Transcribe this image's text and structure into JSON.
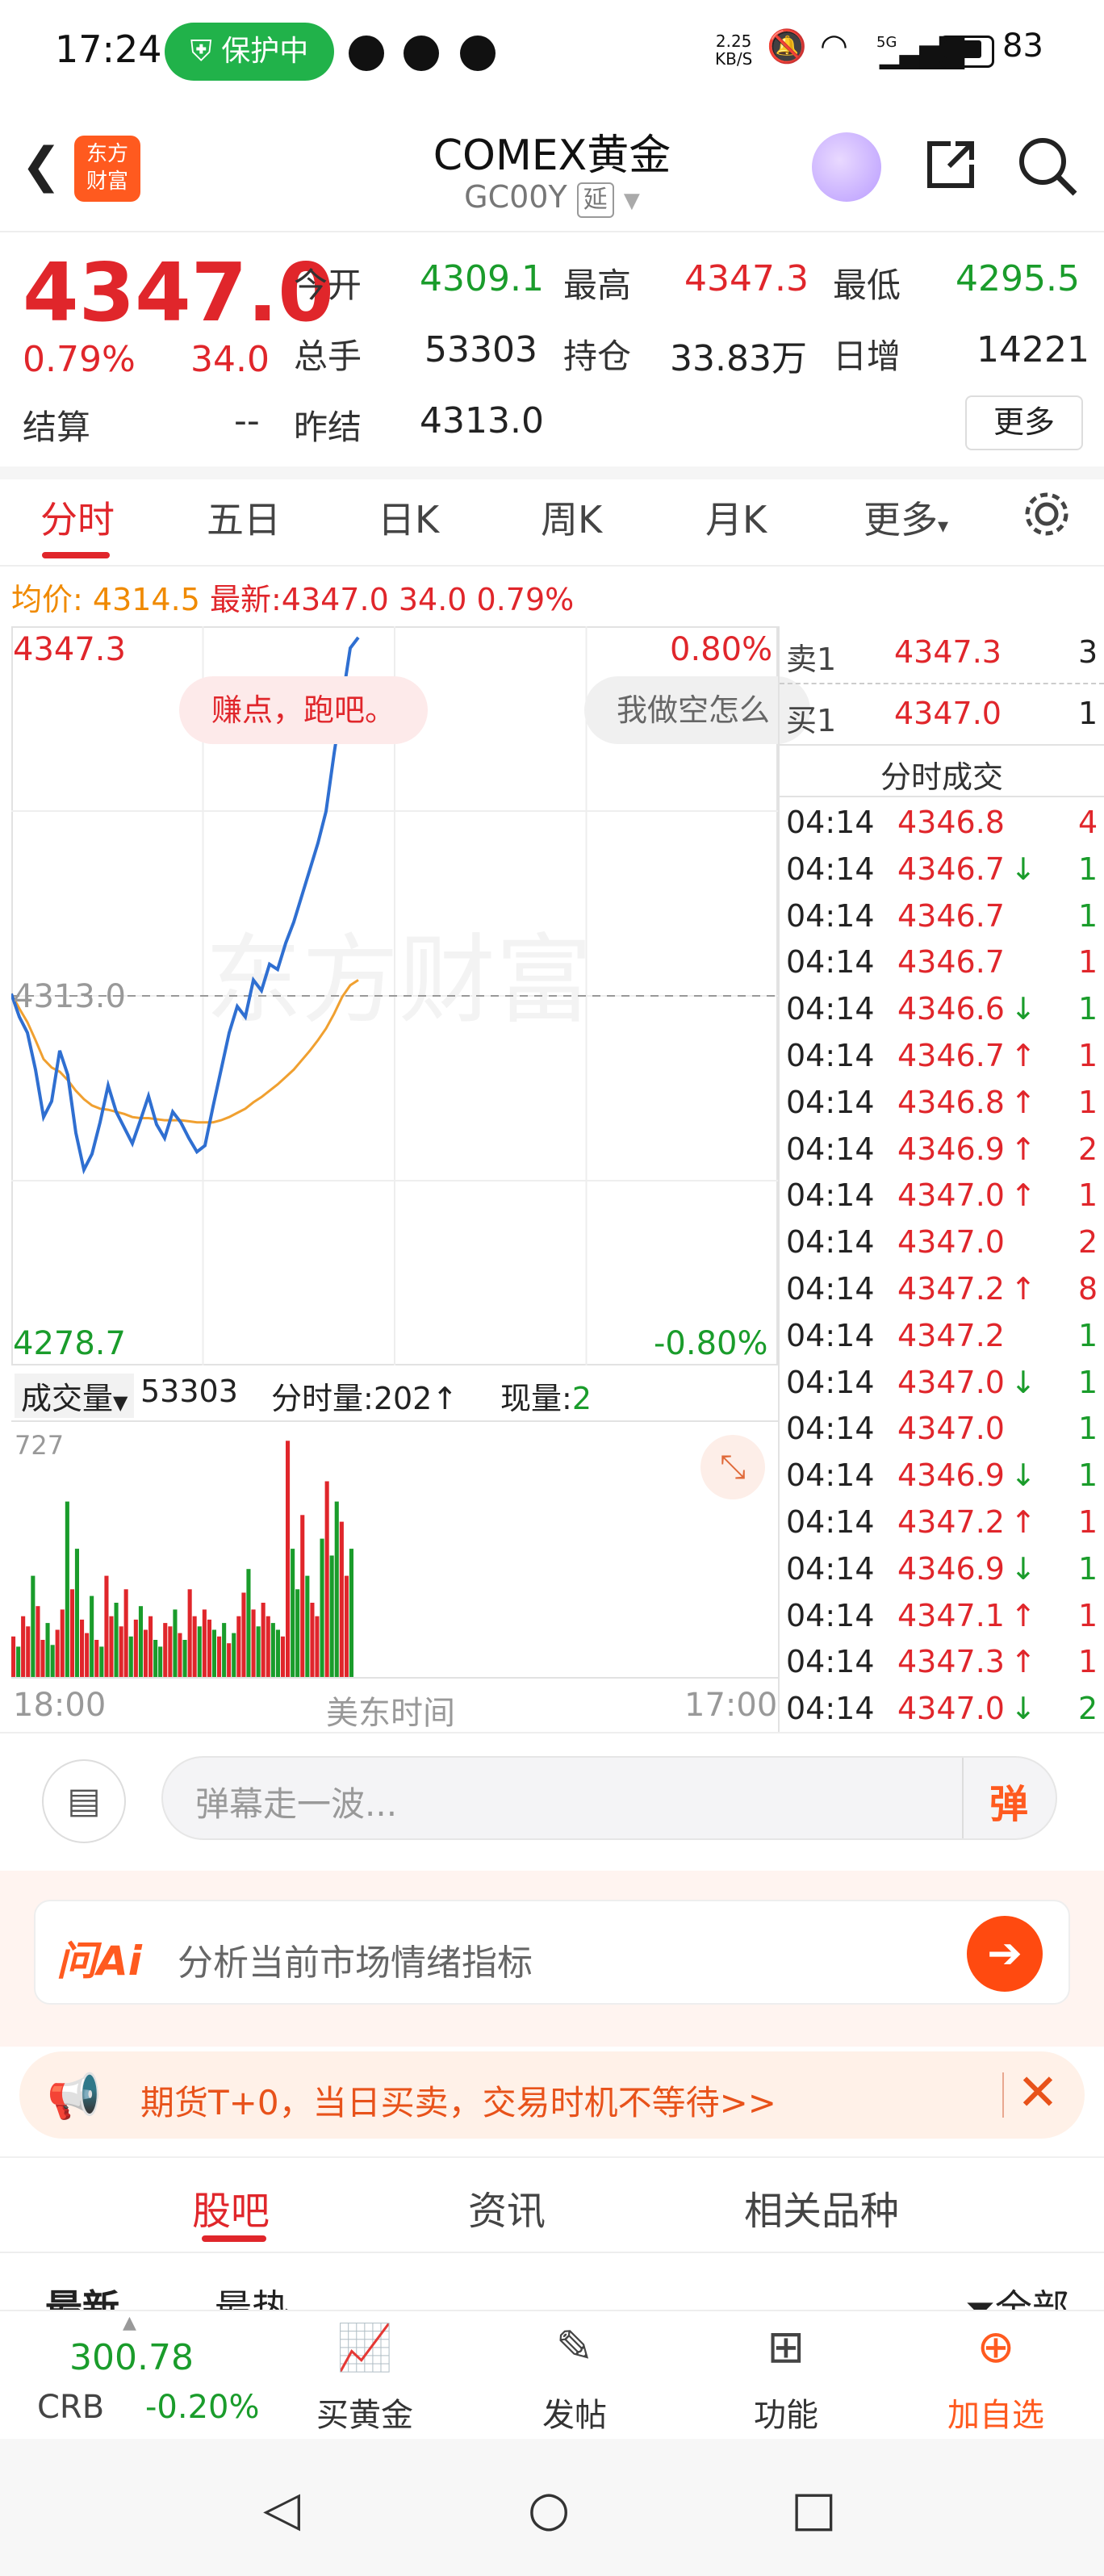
{
  "status_bar": {
    "time": "17:24",
    "protect_label": "保护中",
    "net_speed_top": "2.25",
    "net_speed_bottom": "KB/S",
    "network": "5G",
    "battery": "83"
  },
  "header": {
    "logo_text_1": "东方",
    "logo_text_2": "财富",
    "title": "COMEX黄金",
    "code": "GC00Y",
    "delay_badge": "延"
  },
  "quote": {
    "price": "4347.0",
    "change_pct": "0.79%",
    "change": "34.0",
    "settle_label": "结算",
    "settle_value": "--",
    "open_label": "今开",
    "open_value": "4309.1",
    "high_label": "最高",
    "high_value": "4347.3",
    "low_label": "最低",
    "low_value": "4295.5",
    "volume_label": "总手",
    "volume_value": "53303",
    "position_label": "持仓",
    "position_value": "33.83万",
    "daily_inc_label": "日增",
    "daily_inc_value": "14221",
    "prev_settle_label": "昨结",
    "prev_settle_value": "4313.0",
    "more_label": "更多"
  },
  "tabs": {
    "items": [
      "分时",
      "五日",
      "日K",
      "周K",
      "月K",
      "更多"
    ],
    "active_index": 0
  },
  "avg_line": {
    "avg_label": "均价:",
    "avg_value": "4314.5",
    "latest_label": "最新:",
    "latest_value": "4347.0",
    "change": "34.0",
    "change_pct": "0.79%"
  },
  "chart_data": {
    "type": "line",
    "y_max_label": "4347.3",
    "y_min_label": "4278.7",
    "ref_label": "4313.0",
    "pct_top": "0.80%",
    "pct_bottom": "-0.80%",
    "ylim": [
      4278.7,
      4347.3
    ],
    "reference": 4313.0,
    "x_start": "18:00",
    "x_end": "17:00",
    "x_mid_label": "美东时间",
    "watermark": "东方财富",
    "series": [
      {
        "values": [
          4313.2,
          4311.0,
          4309.5,
          4306.0,
          4301.5,
          4303.0,
          4307.8,
          4305.5,
          4300.0,
          4296.5,
          4298.0,
          4301.0,
          4304.5,
          4302.0,
          4300.5,
          4299.0,
          4301.2,
          4303.5,
          4300.8,
          4299.5,
          4302.0,
          4301.0,
          4299.5,
          4298.2,
          4298.8,
          4302.5,
          4306.0,
          4309.5,
          4312.0,
          4311.0,
          4314.5,
          4313.5,
          4316.0,
          4315.5,
          4318.0,
          4320.0,
          4322.5,
          4325.0,
          4327.5,
          4330.5,
          4336.0,
          4341.0,
          4346.0,
          4347.0
        ]
      },
      {
        "values": [
          4313.2,
          4311.8,
          4310.5,
          4308.8,
          4307.0,
          4306.2,
          4305.8,
          4305.0,
          4304.0,
          4303.2,
          4302.6,
          4302.3,
          4302.2,
          4302.0,
          4301.8,
          4301.5,
          4301.4,
          4301.4,
          4301.3,
          4301.2,
          4301.2,
          4301.2,
          4301.1,
          4301.0,
          4301.0,
          4301.0,
          4301.2,
          4301.5,
          4301.9,
          4302.3,
          4302.9,
          4303.4,
          4304.0,
          4304.6,
          4305.3,
          4306.0,
          4306.9,
          4307.8,
          4308.8,
          4309.9,
          4311.3,
          4312.9,
          4314.0,
          4314.5
        ]
      }
    ]
  },
  "danmaku": {
    "msg1": "赚点，跑吧。",
    "msg2": "我做空怎么"
  },
  "volume": {
    "label": "成交量",
    "total": "53303",
    "minute_label": "分时量:",
    "minute_value": "202",
    "current_label": "现量:",
    "current_value": "2",
    "max_label": "727",
    "bars": [
      120,
      90,
      180,
      150,
      300,
      210,
      110,
      160,
      95,
      140,
      200,
      520,
      260,
      380,
      170,
      130,
      240,
      110,
      90,
      300,
      180,
      220,
      150,
      260,
      120,
      170,
      210,
      140,
      180,
      110,
      90,
      160,
      150,
      200,
      130,
      110,
      260,
      180,
      150,
      200,
      170,
      140,
      120,
      160,
      100,
      130,
      180,
      250,
      320,
      200,
      150,
      220,
      180,
      160,
      140,
      120,
      700,
      380,
      260,
      480,
      300,
      220,
      180,
      410,
      580,
      360,
      520,
      460,
      300,
      380
    ],
    "bar_colors": "rgrrgrrggrrgrgrrgrgrrgrrgrgrrggrrgrgrrgrrgrgrgrrgrgrrggrrggrgrrgrggrrg"
  },
  "right_panel": {
    "ask_label": "卖1",
    "ask_price": "4347.3",
    "ask_vol": "3",
    "bid_label": "买1",
    "bid_price": "4347.0",
    "bid_vol": "1",
    "ticks_title": "分时成交",
    "ticks": [
      {
        "time": "04:14",
        "price": "4346.8",
        "arrow": "",
        "color": "red",
        "vol": "4"
      },
      {
        "time": "04:14",
        "price": "4346.7",
        "arrow": "↓",
        "color": "green",
        "vol": "1"
      },
      {
        "time": "04:14",
        "price": "4346.7",
        "arrow": "",
        "color": "green",
        "vol": "1"
      },
      {
        "time": "04:14",
        "price": "4346.7",
        "arrow": "",
        "color": "red",
        "vol": "1"
      },
      {
        "time": "04:14",
        "price": "4346.6",
        "arrow": "↓",
        "color": "green",
        "vol": "1"
      },
      {
        "time": "04:14",
        "price": "4346.7",
        "arrow": "↑",
        "color": "red",
        "vol": "1"
      },
      {
        "time": "04:14",
        "price": "4346.8",
        "arrow": "↑",
        "color": "red",
        "vol": "1"
      },
      {
        "time": "04:14",
        "price": "4346.9",
        "arrow": "↑",
        "color": "red",
        "vol": "2"
      },
      {
        "time": "04:14",
        "price": "4347.0",
        "arrow": "↑",
        "color": "red",
        "vol": "1"
      },
      {
        "time": "04:14",
        "price": "4347.0",
        "arrow": "",
        "color": "red",
        "vol": "2"
      },
      {
        "time": "04:14",
        "price": "4347.2",
        "arrow": "↑",
        "color": "red",
        "vol": "8"
      },
      {
        "time": "04:14",
        "price": "4347.2",
        "arrow": "",
        "color": "green",
        "vol": "1"
      },
      {
        "time": "04:14",
        "price": "4347.0",
        "arrow": "↓",
        "color": "green",
        "vol": "1"
      },
      {
        "time": "04:14",
        "price": "4347.0",
        "arrow": "",
        "color": "green",
        "vol": "1"
      },
      {
        "time": "04:14",
        "price": "4346.9",
        "arrow": "↓",
        "color": "green",
        "vol": "1"
      },
      {
        "time": "04:14",
        "price": "4347.2",
        "arrow": "↑",
        "color": "red",
        "vol": "1"
      },
      {
        "time": "04:14",
        "price": "4346.9",
        "arrow": "↓",
        "color": "green",
        "vol": "1"
      },
      {
        "time": "04:14",
        "price": "4347.1",
        "arrow": "↑",
        "color": "red",
        "vol": "1"
      },
      {
        "time": "04:14",
        "price": "4347.3",
        "arrow": "↑",
        "color": "red",
        "vol": "1"
      },
      {
        "time": "04:14",
        "price": "4347.0",
        "arrow": "↓",
        "color": "green",
        "vol": "2"
      }
    ]
  },
  "comment_bar": {
    "placeholder": "弹幕走一波...",
    "danmu_btn": "弹"
  },
  "ai_bar": {
    "brand": "问Ai",
    "text": "分析当前市场情绪指标"
  },
  "promo": {
    "text": "期货T+0，当日买卖，交易时机不等待>>"
  },
  "sub_tabs": {
    "items": [
      "股吧",
      "资讯",
      "相关品种"
    ],
    "active_index": 0,
    "peek_left_1": "最新",
    "peek_left_2": "最热",
    "peek_right": "全部"
  },
  "bottom_nav": {
    "crb_value": "300.78",
    "crb_label": "CRB",
    "crb_change": "-0.20%",
    "items": [
      "买黄金",
      "发帖",
      "功能",
      "加自选"
    ]
  },
  "colors": {
    "up": "#e0262b",
    "down": "#1a9c2b",
    "avg": "#f0a030",
    "price_line": "#2f6fd1",
    "brand_orange": "#ff5a1f"
  }
}
